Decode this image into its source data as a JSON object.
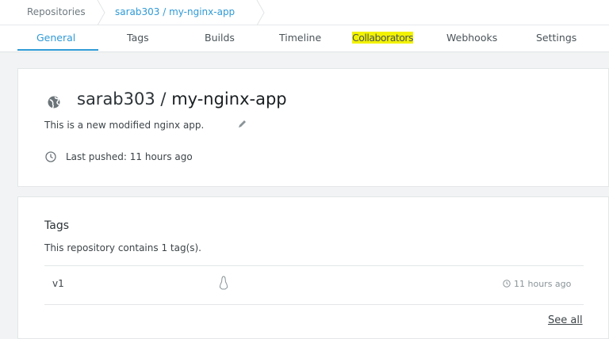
{
  "breadcrumb": {
    "root": "Repositories",
    "current": "sarab303 / my-nginx-app"
  },
  "tabs": [
    {
      "label": "General"
    },
    {
      "label": "Tags"
    },
    {
      "label": "Builds"
    },
    {
      "label": "Timeline"
    },
    {
      "label": "Collaborators"
    },
    {
      "label": "Webhooks"
    },
    {
      "label": "Settings"
    }
  ],
  "repo": {
    "owner": "sarab303",
    "separator": "/",
    "name": "my-nginx-app",
    "description": "This is a new modified nginx app.",
    "last_pushed": "Last pushed: 11 hours ago"
  },
  "tags": {
    "title": "Tags",
    "summary": "This repository contains 1 tag(s).",
    "rows": [
      {
        "name": "v1",
        "os_icon": "linux-icon",
        "time": "11 hours ago"
      }
    ],
    "see_all": "See all"
  },
  "colors": {
    "accent": "#2f9ad6",
    "highlight": "#f2f200"
  }
}
